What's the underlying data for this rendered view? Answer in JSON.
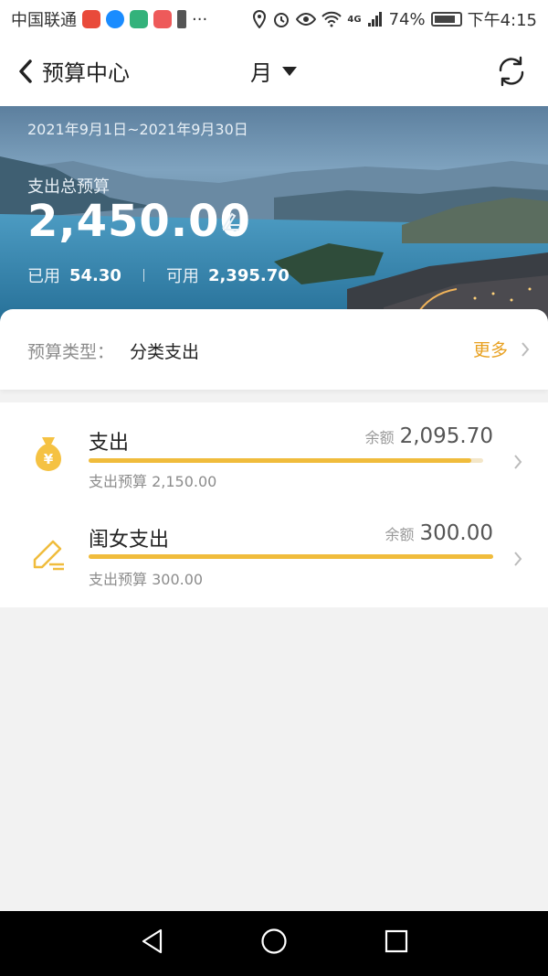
{
  "status": {
    "carrier": "中国联通",
    "network": "4G",
    "battery": "74%",
    "time": "下午4:15"
  },
  "nav": {
    "back_title": "预算中心",
    "period": "月"
  },
  "banner": {
    "date_range": "2021年9月1日~2021年9月30日",
    "total_label": "支出总预算",
    "total_amount": "2,450.00",
    "used_label": "已用",
    "used_value": "54.30",
    "available_label": "可用",
    "available_value": "2,395.70"
  },
  "type_card": {
    "label": "预算类型：",
    "value": "分类支出",
    "more": "更多"
  },
  "items": [
    {
      "name": "支出",
      "balance_label": "余额",
      "balance": "2,095.70",
      "progress": 0.97,
      "sub": "支出预算 2,150.00",
      "icon": "money-bag-icon"
    },
    {
      "name": "闺女支出",
      "balance_label": "余额",
      "balance": "300.00",
      "progress": 1.0,
      "sub": "支出预算 300.00",
      "icon": "pencil-icon"
    }
  ],
  "colors": {
    "accent": "#e8a020",
    "bar": "#f0bc3c",
    "background": "#f2f2f2"
  }
}
